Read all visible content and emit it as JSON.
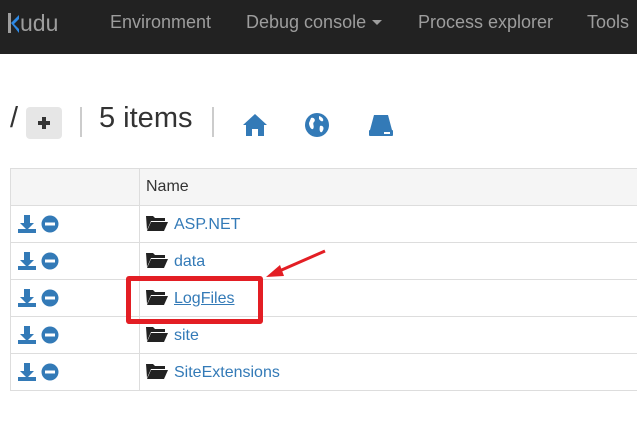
{
  "nav": {
    "brand_rest": "udu",
    "items": [
      {
        "label": "Environment"
      },
      {
        "label": "Debug console"
      },
      {
        "label": "Process explorer"
      },
      {
        "label": "Tools"
      }
    ]
  },
  "toolbar": {
    "path": "/",
    "item_count": "5 items"
  },
  "table": {
    "header": {
      "name": "Name"
    },
    "rows": [
      {
        "name": "ASP.NET"
      },
      {
        "name": "data"
      },
      {
        "name": "LogFiles"
      },
      {
        "name": "site"
      },
      {
        "name": "SiteExtensions"
      }
    ]
  },
  "colors": {
    "navbar": "#222222",
    "link": "#337ab7",
    "highlight": "#e31e24"
  }
}
